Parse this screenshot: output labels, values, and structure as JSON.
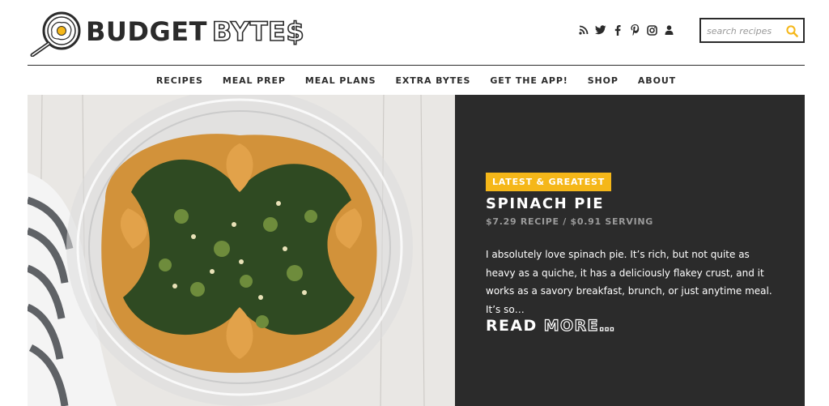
{
  "brand": {
    "part1": "BUDGET",
    "part2": "BYTE$"
  },
  "social": [
    "rss-icon",
    "twitter-icon",
    "facebook-icon",
    "pinterest-icon",
    "instagram-icon",
    "user-icon"
  ],
  "search": {
    "placeholder": "search recipes"
  },
  "nav": {
    "items": [
      {
        "label": "RECIPES"
      },
      {
        "label": "MEAL PREP"
      },
      {
        "label": "MEAL PLANS"
      },
      {
        "label": "EXTRA BYTES"
      },
      {
        "label": "GET THE APP!"
      },
      {
        "label": "SHOP"
      },
      {
        "label": "ABOUT"
      }
    ]
  },
  "featured": {
    "badge": "LATEST & GREATEST",
    "title": "SPINACH PIE",
    "cost": "$7.29 RECIPE / $0.91 SERVING",
    "excerpt": "I absolutely love spinach pie. It’s rich, but not quite as heavy as a quiche, it has a deliciously flakey crust, and it works as a savory breakfast, brunch, or just anytime meal. It’s so…",
    "read_more_1": "READ",
    "read_more_2": "MORE…"
  },
  "colors": {
    "accent": "#f5b719",
    "dark": "#2b2b2b",
    "muted": "#9a9a9a"
  }
}
